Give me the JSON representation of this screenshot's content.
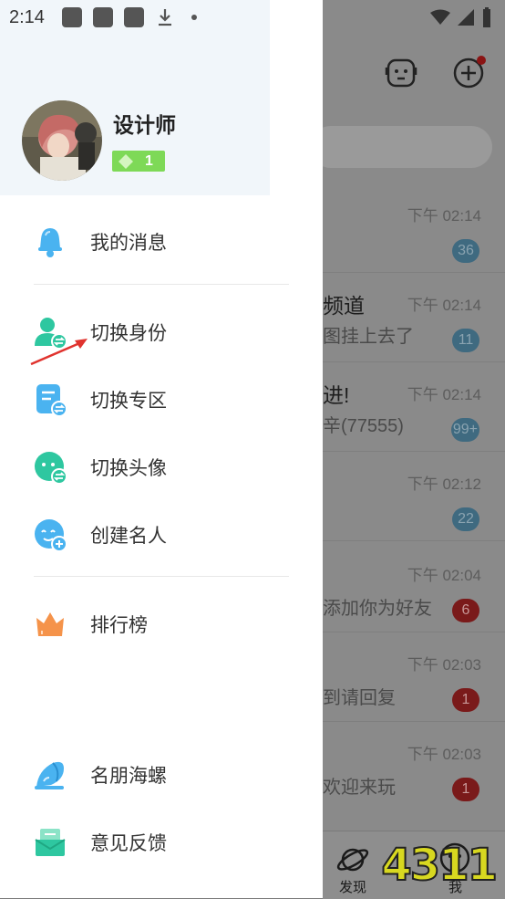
{
  "status": {
    "time": "2:14"
  },
  "profile": {
    "name": "设计师",
    "level": "1"
  },
  "menu": [
    {
      "label": "我的消息"
    },
    {
      "label": "切换身份"
    },
    {
      "label": "切换专区"
    },
    {
      "label": "切换头像"
    },
    {
      "label": "创建名人"
    },
    {
      "label": "排行榜"
    },
    {
      "label": "名朋海螺"
    },
    {
      "label": "意见反馈"
    }
  ],
  "background": {
    "chats": [
      {
        "time": "下午 02:14",
        "title": "",
        "sub": "",
        "badge": "36",
        "badge_color": "blue"
      },
      {
        "time": "下午 02:14",
        "title": "频道",
        "sub": "图挂上去了",
        "badge": "11",
        "badge_color": "blue"
      },
      {
        "time": "下午 02:14",
        "title": "进!",
        "sub": "辛(77555)",
        "badge": "99+",
        "badge_color": "blue"
      },
      {
        "time": "下午 02:12",
        "title": "",
        "sub": "",
        "badge": "22",
        "badge_color": "blue"
      },
      {
        "time": "下午 02:04",
        "title": "",
        "sub": "添加你为好友",
        "badge": "6",
        "badge_color": "red"
      },
      {
        "time": "下午 02:03",
        "title": "",
        "sub": "到请回复",
        "badge": "1",
        "badge_color": "red"
      },
      {
        "time": "下午 02:03",
        "title": "",
        "sub": "欢迎来玩",
        "badge": "1",
        "badge_color": "red"
      }
    ],
    "nav_discover": "发现",
    "nav_me": "我",
    "watermark": "4311"
  },
  "colors": {
    "accent_blue": "#4ab3f0",
    "accent_green": "#2ec7a0",
    "badge_green": "#7ed957"
  },
  "icons": [
    "bell-icon",
    "switch-identity-icon",
    "switch-zone-icon",
    "switch-avatar-icon",
    "create-celebrity-icon",
    "ranking-crown-icon",
    "conch-icon",
    "feedback-icon"
  ]
}
